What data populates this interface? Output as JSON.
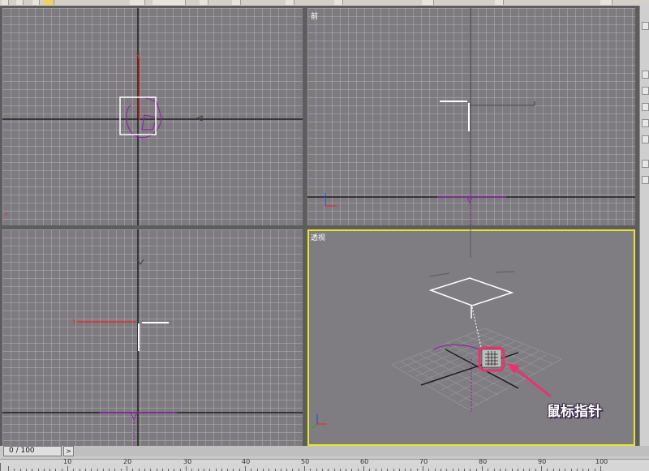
{
  "viewports": {
    "top_left": {
      "label": ""
    },
    "front": {
      "label": "前"
    },
    "left": {
      "label": ""
    },
    "perspective": {
      "label": "透视",
      "active": true
    }
  },
  "annotation": {
    "text": "鼠标指针",
    "color": "#e8336e"
  },
  "timeline": {
    "frame": "0 / 100",
    "next_icon": "chevron-right-icon"
  },
  "ruler": {
    "ticks": [
      "10",
      "20",
      "30",
      "40",
      "50",
      "60",
      "70",
      "80",
      "90",
      "100"
    ]
  },
  "colors": {
    "viewport_bg": "#7e7b80",
    "active_border": "#e6e62a",
    "x_axis": "#e03030",
    "gizmo": "#8a2aa0"
  }
}
